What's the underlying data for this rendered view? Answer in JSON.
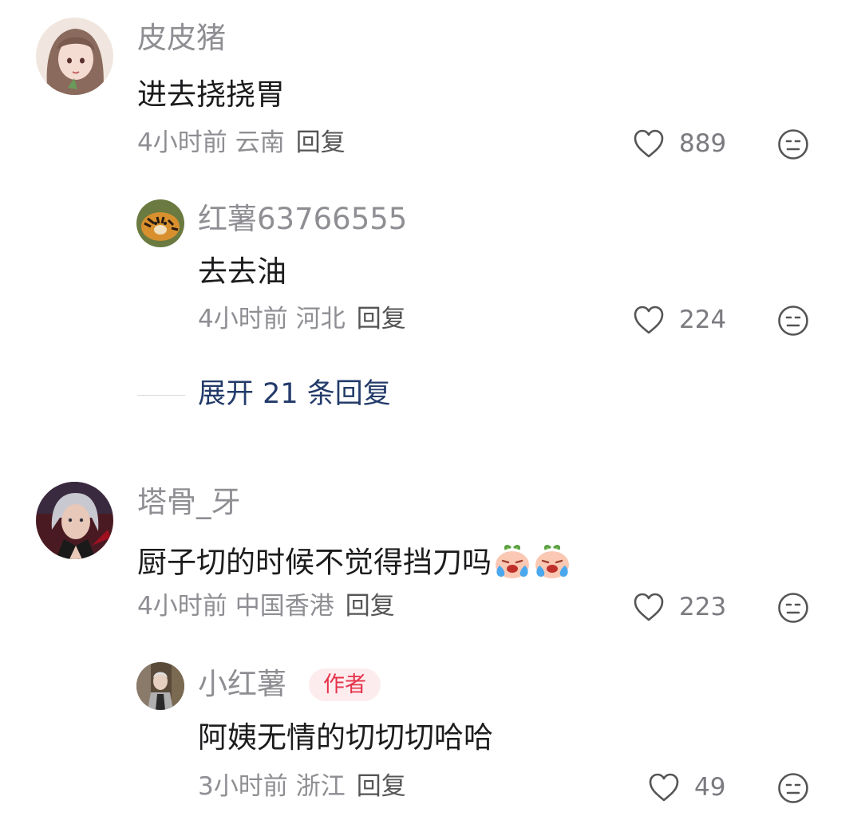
{
  "comments": [
    {
      "username": "皮皮猪",
      "text": "进去挠挠胃",
      "time": "4小时前",
      "location": "云南",
      "reply_label": "回复",
      "likes": "889",
      "replies": [
        {
          "username": "红薯63766555",
          "text": "去去油",
          "time": "4小时前",
          "location": "河北",
          "reply_label": "回复",
          "likes": "224"
        }
      ],
      "expand_label": "展开 21 条回复"
    },
    {
      "username": "塔骨_牙",
      "text": "厨子切的时候不觉得挡刀吗",
      "emojis": [
        "crying-emoji",
        "crying-emoji"
      ],
      "time": "4小时前",
      "location": "中国香港",
      "reply_label": "回复",
      "likes": "223",
      "replies": [
        {
          "username": "小红薯",
          "badge": "作者",
          "text": "阿姨无情的切切切哈哈",
          "time": "3小时前",
          "location": "浙江",
          "reply_label": "回复",
          "likes": "49"
        }
      ]
    }
  ],
  "colors": {
    "username": "#8e8e93",
    "text": "#1c1c1e",
    "expand": "#233b6a",
    "badge_text": "#e5334b",
    "badge_bg": "#fdecee"
  }
}
